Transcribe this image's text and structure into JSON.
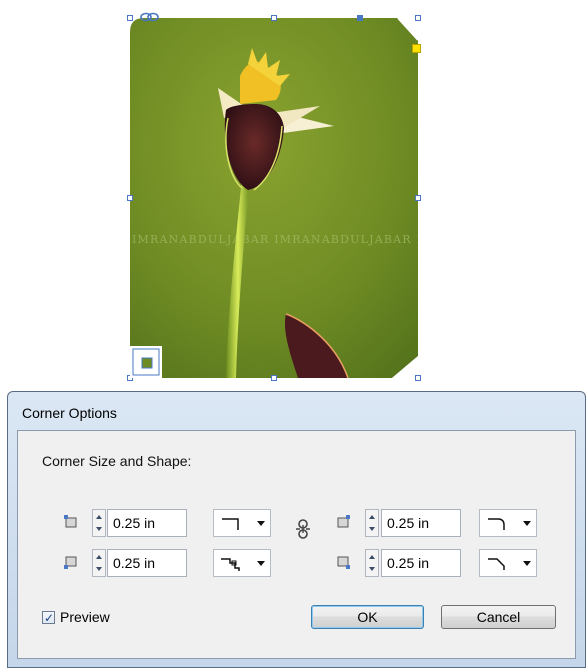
{
  "dialog": {
    "title": "Corner Options",
    "heading": "Corner Size and Shape:",
    "corners": {
      "top_left": {
        "value": "0.25 in",
        "shape": "fancy-corner-icon"
      },
      "top_right": {
        "value": "0.25 in",
        "shape": "rounded-corner-icon"
      },
      "bottom_left": {
        "value": "0.25 in",
        "shape": "inset-corner-icon"
      },
      "bottom_right": {
        "value": "0.25 in",
        "shape": "bevel-corner-icon"
      }
    },
    "link_icon": "chain-link-icon",
    "preview": {
      "label": "Preview",
      "checked": true
    },
    "buttons": {
      "ok": "OK",
      "cancel": "Cancel"
    }
  },
  "canvas": {
    "watermark": "IMRANABDULJABAR   IMRANABDULJABAR   IMRANABDUL",
    "colors": {
      "background": "#6f8f25",
      "selection": "#4a78c4",
      "live_corner_handle": "#ffe100"
    }
  }
}
